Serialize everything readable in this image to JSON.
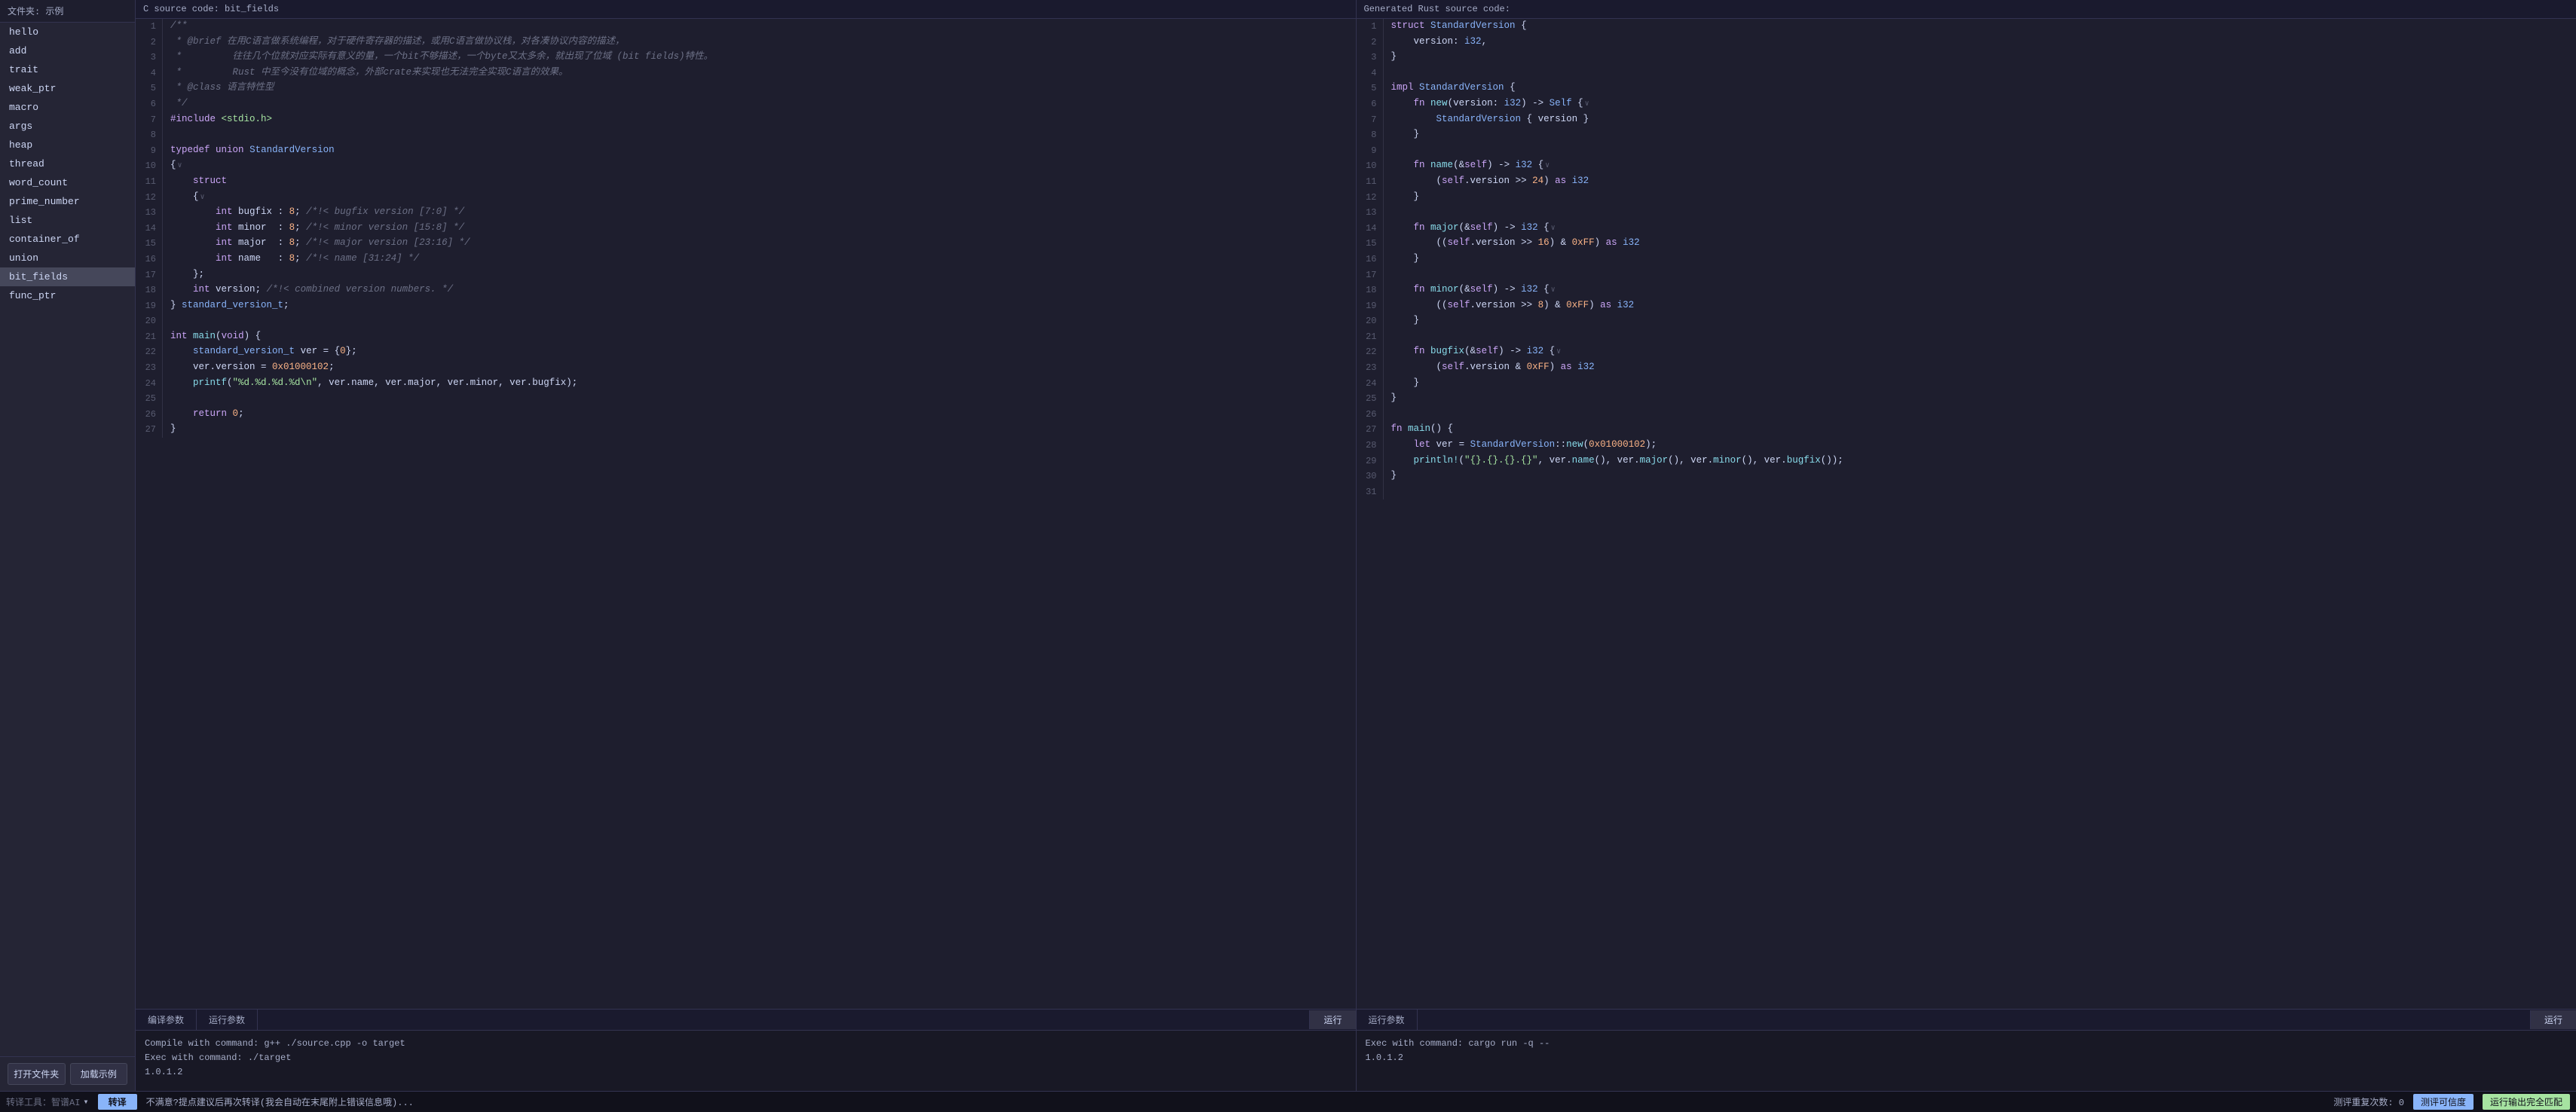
{
  "sidebar": {
    "title": "文件夹: 示例",
    "items": [
      {
        "label": "hello",
        "active": false
      },
      {
        "label": "add",
        "active": false
      },
      {
        "label": "trait",
        "active": false
      },
      {
        "label": "weak_ptr",
        "active": false
      },
      {
        "label": "macro",
        "active": false
      },
      {
        "label": "args",
        "active": false
      },
      {
        "label": "heap",
        "active": false
      },
      {
        "label": "thread",
        "active": false
      },
      {
        "label": "word_count",
        "active": false
      },
      {
        "label": "prime_number",
        "active": false
      },
      {
        "label": "list",
        "active": false
      },
      {
        "label": "container_of",
        "active": false
      },
      {
        "label": "union",
        "active": false
      },
      {
        "label": "bit_fields",
        "active": true
      },
      {
        "label": "func_ptr",
        "active": false
      }
    ],
    "open_folder_btn": "打开文件夹",
    "load_example_btn": "加载示例"
  },
  "c_panel": {
    "header": "C source code: bit_fields"
  },
  "rust_panel": {
    "header": "Generated Rust source code:"
  },
  "bottom": {
    "c_compile_tab": "编译参数",
    "c_run_tab": "运行参数",
    "c_run_btn": "运行",
    "c_output": [
      "Compile with command: g++ ./source.cpp -o target",
      "Exec with command: ./target",
      "1.0.1.2"
    ],
    "rust_compile_tab": "运行参数",
    "rust_run_btn": "运行",
    "rust_output": [
      "Exec with command: cargo run -q --",
      "1.0.1.2"
    ]
  },
  "status_bar": {
    "tool_label": "转译工具：智谱AI",
    "translate_btn": "转译",
    "hint": "不满意?提点建议后再次转译(我会自动在末尾附上错误信息哦)...",
    "repeat_count_label": "测评重复次数: 0",
    "confidence_btn": "测评可信度",
    "match_btn": "运行输出完全匹配"
  }
}
